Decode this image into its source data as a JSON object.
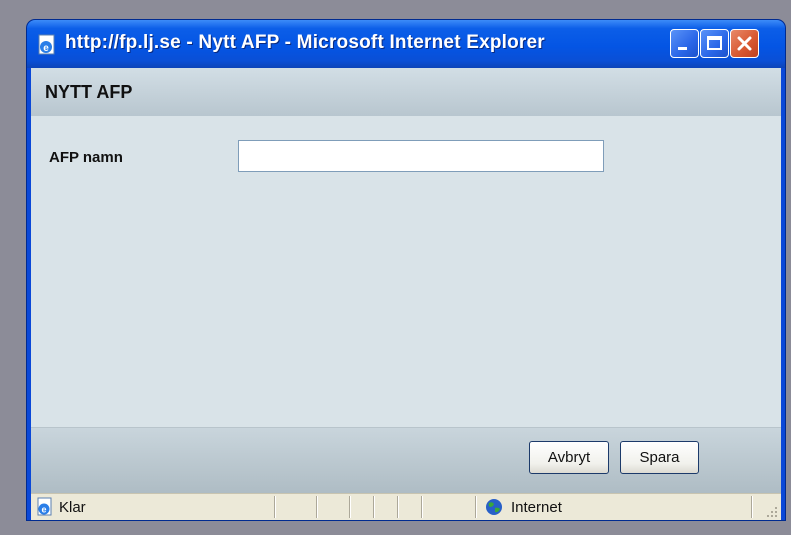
{
  "window": {
    "title": "http://fp.lj.se - Nytt AFP - Microsoft Internet Explorer",
    "controls": {
      "minimize": "minimize",
      "maximize": "maximize",
      "close": "close"
    }
  },
  "page": {
    "title": "NYTT AFP",
    "form": {
      "name_label": "AFP namn",
      "name_value": "",
      "name_placeholder": ""
    },
    "buttons": {
      "cancel": "Avbryt",
      "save": "Spara"
    }
  },
  "statusbar": {
    "status": "Klar",
    "zone": "Internet"
  },
  "icons": {
    "title": "ie-page-icon",
    "status": "ie-page-icon",
    "zone": "globe-icon",
    "resize": "resize-grip-icon"
  },
  "colors": {
    "titlebar": "#0455e4",
    "close_button": "#d95a33",
    "content_background": "#d9e3e8",
    "statusbar": "#ece9d8"
  }
}
